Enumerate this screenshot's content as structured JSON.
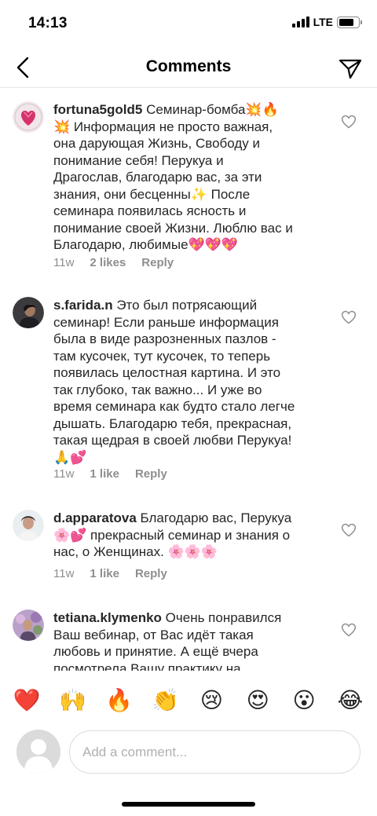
{
  "status_bar": {
    "time": "14:13",
    "network": "LTE",
    "battery_level": 0.8
  },
  "header": {
    "title": "Comments",
    "back_icon": "chevron-left-icon",
    "send_icon": "paper-plane-icon"
  },
  "comments": [
    {
      "username": "fortuna5gold5",
      "text": " Семинар-бомба💥🔥\n💥 Информация не просто важная,\nона дарующая Жизнь, Свободу и\nпонимание себя! Перукуа и\nДрагослав, благодарю вас, за эти\nзнания, они бесценны✨ После\nсеминара появилась ясность и\nпонимание своей Жизни. Люблю вас и\nБлагодарю, любимые💖💖💖",
      "time": "11w",
      "likes": "2 likes",
      "reply": "Reply"
    },
    {
      "username": "s.farida.n",
      "text": " Это был потрясающий\nсеминар! Если раньше информация\nбыла в виде разрозненных пазлов -\nтам кусочек, тут кусочек, то теперь\nпоявилась целостная картина. И это\nтак глубоко, так важно... И уже во\nвремя семинара как будто стало легче\nдышать. Благодарю тебя,  прекрасная,\nтакая щедрая в своей любви Перукуа!\n🙏💕",
      "time": "11w",
      "likes": "1 like",
      "reply": "Reply"
    },
    {
      "username": "d.apparatova",
      "text": " Благодарю вас, Перукуа\n🌸💕 прекрасный семинар и знания о\nнас, о Женщинах. 🌸🌸🌸",
      "time": "11w",
      "likes": "1 like",
      "reply": "Reply"
    },
    {
      "username": "tetiana.klymenko",
      "text": " Очень понравился\nВаш вебинар, от Вас идёт такая\nлюбовь и принятие. А ещё вчера\nпосмотрела Вашу практику на",
      "time": "",
      "likes": "",
      "reply": ""
    }
  ],
  "emoji_bar": [
    "❤️",
    "🙌",
    "🔥",
    "👏",
    "😢",
    "😍",
    "😮",
    "😂"
  ],
  "composer": {
    "placeholder": "Add a comment..."
  },
  "colors": {
    "text": "#262626",
    "meta": "#8e8e8e",
    "divider": "#e6e6e6",
    "input_border": "#dbdbdb"
  }
}
